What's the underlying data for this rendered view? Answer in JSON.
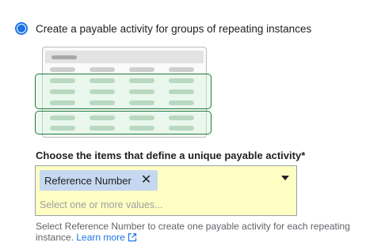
{
  "option": {
    "label": "Create a payable activity for groups of repeating instances",
    "selected": true
  },
  "field": {
    "label": "Choose the items that define a unique payable activity*",
    "chips": [
      {
        "label": "Reference Number"
      }
    ],
    "placeholder": "Select one or more values...",
    "background_color": "#ffffc4"
  },
  "help": {
    "text": "Select Reference Number to create one payable activity for each repeating instance.",
    "link_label": "Learn more"
  },
  "colors": {
    "accent": "#1a73e8",
    "group_border": "#1e7a3a",
    "chip_bg": "#c6d8ef"
  },
  "icons": {
    "remove": "close-icon",
    "dropdown": "triangle-down-icon",
    "external": "external-link-icon"
  }
}
